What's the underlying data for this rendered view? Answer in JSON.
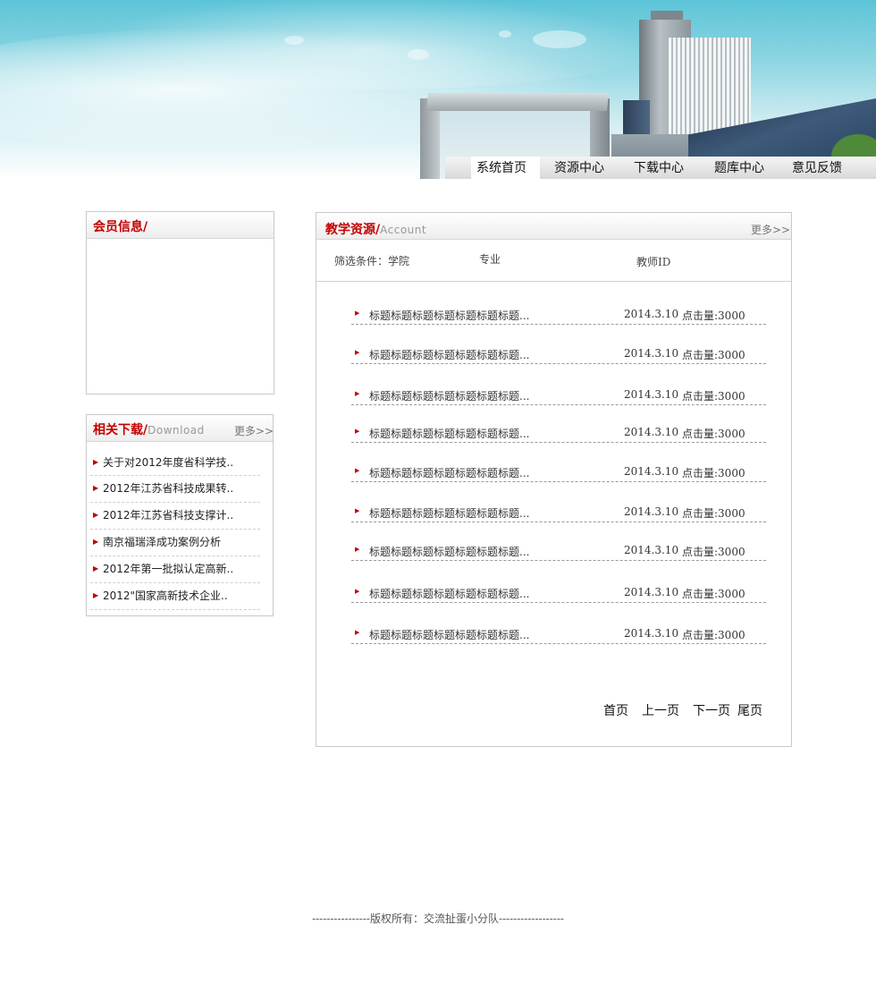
{
  "nav": {
    "items": [
      {
        "label": "系统首页",
        "active": true
      },
      {
        "label": "资源中心",
        "active": false
      },
      {
        "label": "下载中心",
        "active": false
      },
      {
        "label": "题库中心",
        "active": false
      },
      {
        "label": "意见反馈",
        "active": false
      }
    ]
  },
  "member": {
    "title": "会员信息/"
  },
  "download": {
    "title": "相关下载/",
    "title_en": "Download",
    "more": "更多>>",
    "items": [
      "关于对2012年度省科学技..",
      "2012年江苏省科技成果转..",
      "2012年江苏省科技支撑计..",
      "南京福瑞泽成功案例分析",
      "2012年第一批拟认定高新..",
      "2012\"国家高新技术企业.."
    ]
  },
  "resource": {
    "title": "教学资源/",
    "title_en": "Account",
    "more": "更多>>",
    "filter": {
      "label": "筛选条件：学院",
      "major": "专业",
      "teacher": "教师ID"
    },
    "rows": [
      {
        "title": "标题标题标题标题标题标题标题...",
        "date": "2014.3.10",
        "hits": "点击量:3000"
      },
      {
        "title": "标题标题标题标题标题标题标题...",
        "date": "2014.3.10",
        "hits": "点击量:3000"
      },
      {
        "title": "标题标题标题标题标题标题标题...",
        "date": "2014.3.10",
        "hits": "点击量:3000"
      },
      {
        "title": "标题标题标题标题标题标题标题...",
        "date": "2014.3.10",
        "hits": "点击量:3000"
      },
      {
        "title": "标题标题标题标题标题标题标题...",
        "date": "2014.3.10",
        "hits": "点击量:3000"
      },
      {
        "title": "标题标题标题标题标题标题标题...",
        "date": "2014.3.10",
        "hits": "点击量:3000"
      },
      {
        "title": "标题标题标题标题标题标题标题...",
        "date": "2014.3.10",
        "hits": "点击量:3000"
      },
      {
        "title": "标题标题标题标题标题标题标题...",
        "date": "2014.3.10",
        "hits": "点击量:3000"
      },
      {
        "title": "标题标题标题标题标题标题标题...",
        "date": "2014.3.10",
        "hits": "点击量:3000"
      }
    ],
    "pager": {
      "first": "首页",
      "prev": "上一页",
      "next": "下一页",
      "last": "尾页"
    }
  },
  "footer": {
    "text": "----------------版权所有：交流扯蛋小分队------------------"
  },
  "colors": {
    "accent_red": "#c40000",
    "sky_top": "#5cc4d8",
    "nav_bg": "#d9d9d9"
  },
  "icons": {
    "list_bullet": "red-triangle-bullet-icon"
  }
}
